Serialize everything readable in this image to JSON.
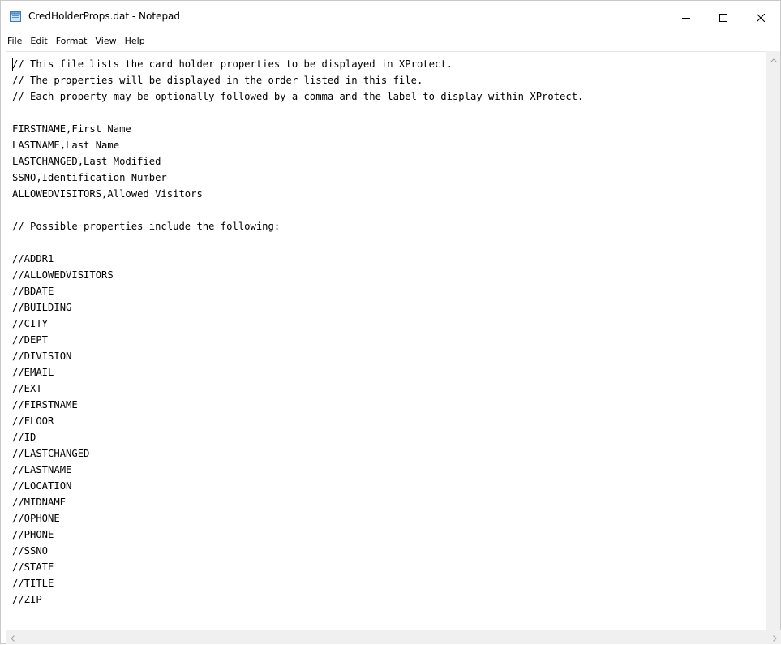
{
  "window": {
    "title": "CredHolderProps.dat - Notepad",
    "app_icon": "notepad-icon"
  },
  "caption_buttons": {
    "minimize_icon": "minimize-icon",
    "maximize_icon": "maximize-icon",
    "close_icon": "close-icon"
  },
  "menubar": {
    "items": [
      {
        "label": "File"
      },
      {
        "label": "Edit"
      },
      {
        "label": "Format"
      },
      {
        "label": "View"
      },
      {
        "label": "Help"
      }
    ]
  },
  "editor": {
    "lines": [
      "// This file lists the card holder properties to be displayed in XProtect.",
      "// The properties will be displayed in the order listed in this file.",
      "// Each property may be optionally followed by a comma and the label to display within XProtect.",
      "",
      "FIRSTNAME,First Name",
      "LASTNAME,Last Name",
      "LASTCHANGED,Last Modified",
      "SSNO,Identification Number",
      "ALLOWEDVISITORS,Allowed Visitors",
      "",
      "// Possible properties include the following:",
      "",
      "//ADDR1",
      "//ALLOWEDVISITORS",
      "//BDATE",
      "//BUILDING",
      "//CITY",
      "//DEPT",
      "//DIVISION",
      "//EMAIL",
      "//EXT",
      "//FIRSTNAME",
      "//FLOOR",
      "//ID",
      "//LASTCHANGED",
      "//LASTNAME",
      "//LOCATION",
      "//MIDNAME",
      "//OPHONE",
      "//PHONE",
      "//SSNO",
      "//STATE",
      "//TITLE",
      "//ZIP"
    ]
  },
  "scrollbars": {
    "up_arrow_icon": "scroll-up-arrow-icon",
    "left_arrow_icon": "scroll-left-arrow-icon",
    "right_arrow_icon": "scroll-right-arrow-icon"
  }
}
